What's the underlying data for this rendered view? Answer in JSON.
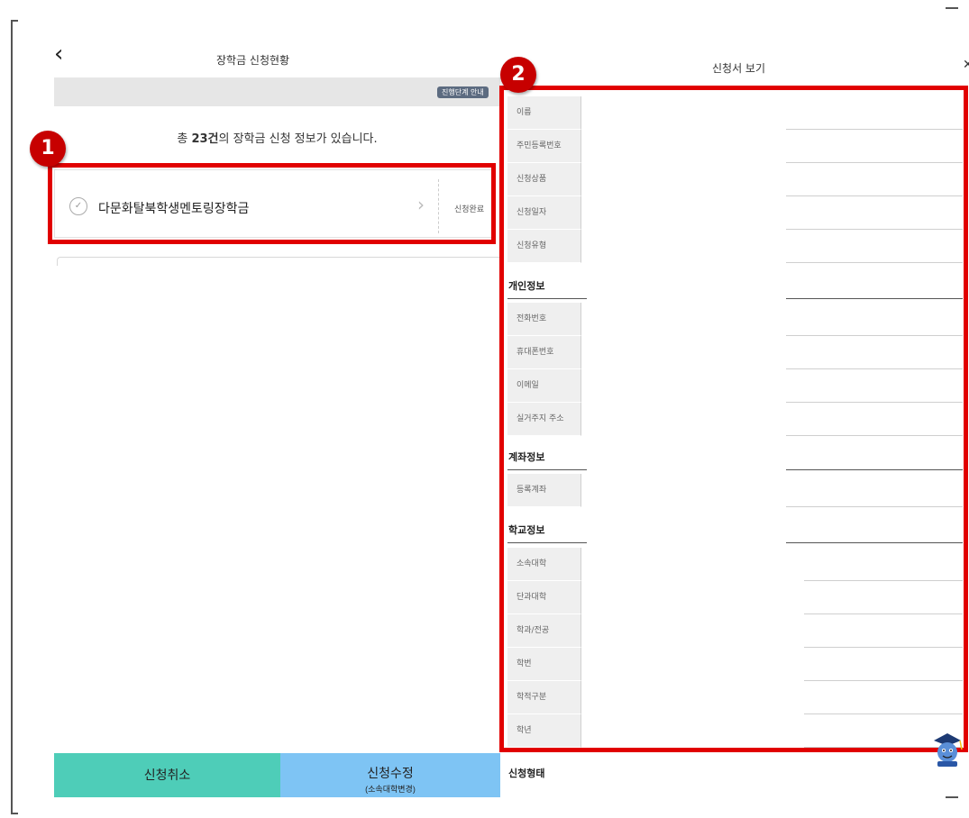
{
  "left": {
    "back_icon": "chevron-left-icon",
    "title": "장학금 신청현황",
    "guide_button": "진행단계 안내",
    "summary_prefix": "총 ",
    "summary_count": "23건",
    "summary_suffix": "의 장학금 신청 정보가 있습니다.",
    "item": {
      "name": "다문화탈북학생멘토링장학금",
      "status": "신청완료"
    },
    "cancel_button": "신청취소",
    "modify_button": "신청수정",
    "modify_sub": "(소속대학변경)"
  },
  "right": {
    "title": "신청서 보기",
    "close_icon": "close-icon",
    "rows_top": [
      "이름",
      "주민등록번호",
      "신청상품",
      "신청일자",
      "신청유형"
    ],
    "section_personal": "개인정보",
    "rows_personal": [
      "전화번호",
      "휴대폰번호",
      "이메일",
      "실거주지 주소"
    ],
    "section_account": "계좌정보",
    "rows_account": [
      "등록계좌"
    ],
    "section_school": "학교정보",
    "rows_school": [
      "소속대학",
      "단과대학",
      "학과/전공",
      "학번",
      "학적구분",
      "학년"
    ],
    "section_type": "신청형태"
  },
  "annotations": {
    "badge1": "1",
    "badge2": "2",
    "color": "#e10000"
  },
  "colors": {
    "cancel_bg": "#4ecdb8",
    "modify_bg": "#7ec4f4"
  }
}
